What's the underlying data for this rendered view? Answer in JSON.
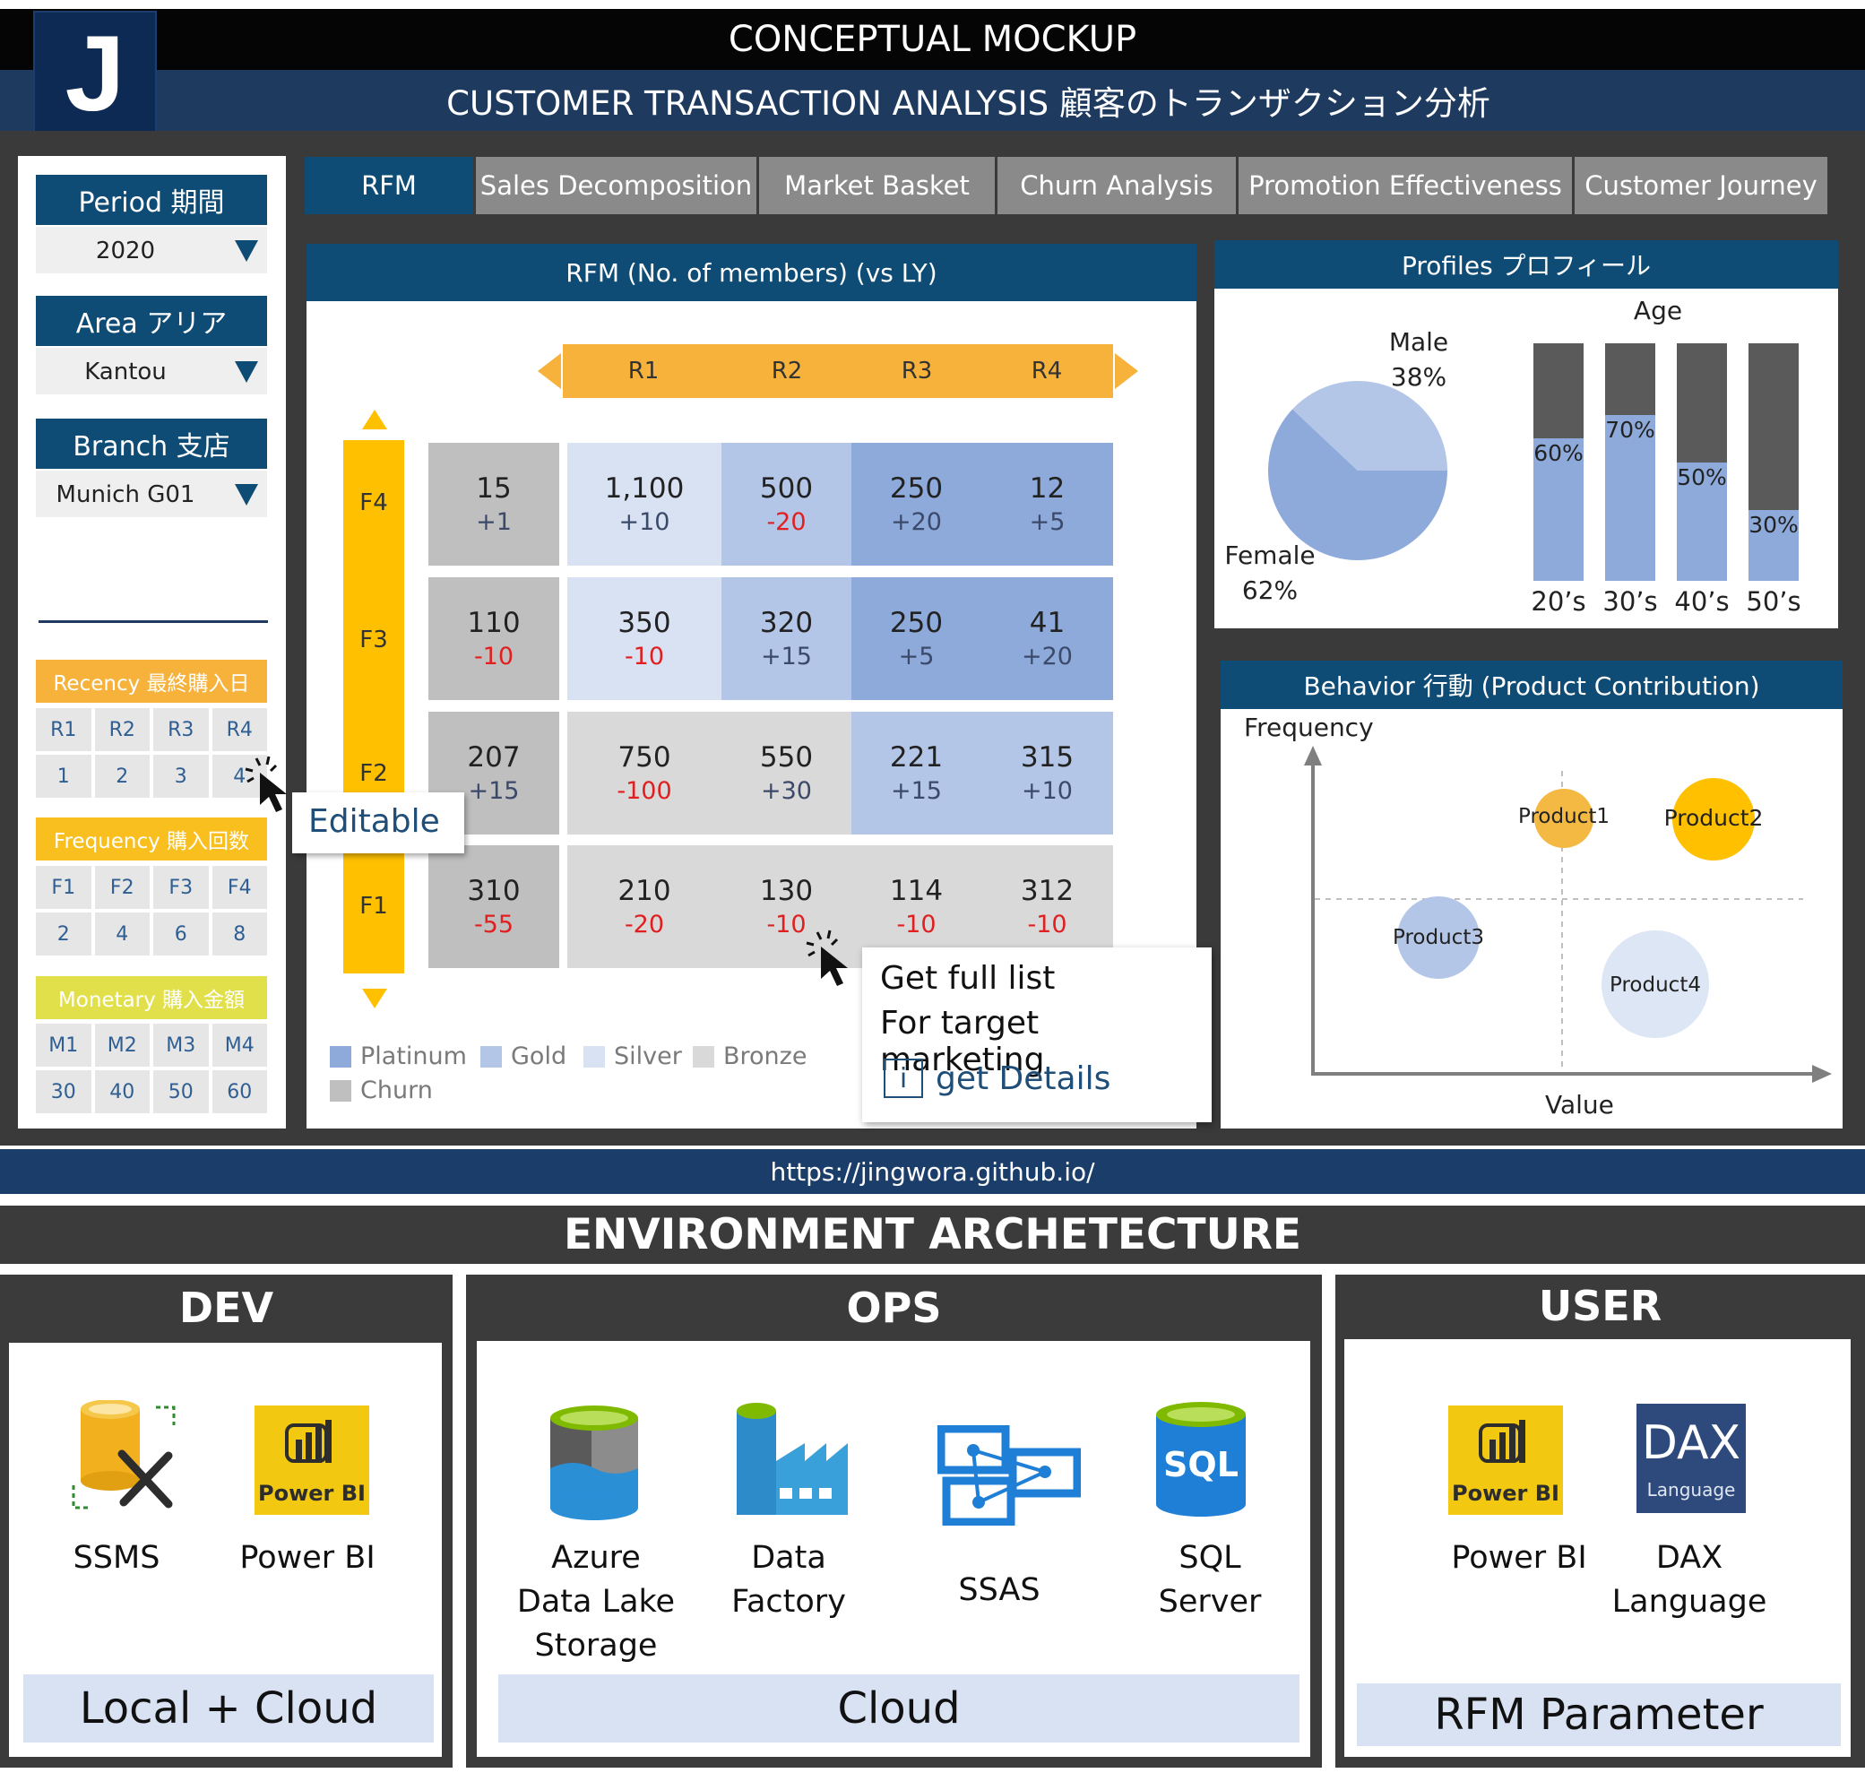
{
  "header": {
    "title": "CONCEPTUAL MOCKUP",
    "subtitle": "CUSTOMER TRANSACTION ANALYSIS 顧客のトランザクション分析",
    "logo_letter": "J"
  },
  "filters": {
    "period": {
      "label": "Period 期間",
      "value": "2020"
    },
    "area": {
      "label": "Area アリア",
      "value": "Kantou"
    },
    "branch": {
      "label": "Branch 支店",
      "value": "Munich G01"
    }
  },
  "params": {
    "recency": {
      "label": "Recency 最終購入日",
      "color": "#f6b23a",
      "headers": [
        "R1",
        "R2",
        "R3",
        "R4"
      ],
      "values": [
        "1",
        "2",
        "3",
        "4"
      ]
    },
    "frequency": {
      "label": "Frequency 購入回数",
      "color": "#f8bf1e",
      "headers": [
        "F1",
        "F2",
        "F3",
        "F4"
      ],
      "values": [
        "2",
        "4",
        "6",
        "8"
      ]
    },
    "monetary": {
      "label": "Monetary 購入金額",
      "color": "#e2e04a",
      "headers": [
        "M1",
        "M2",
        "M3",
        "M4"
      ],
      "values": [
        "30",
        "40",
        "50",
        "60"
      ]
    }
  },
  "editable_callout": "Editable",
  "tabs": [
    "RFM",
    "Sales Decomposition",
    "Market Basket",
    "Churn Analysis",
    "Promotion Effectiveness",
    "Customer Journey"
  ],
  "rfm": {
    "title": "RFM (No. of members) (vs LY)",
    "r_labels": [
      "R1",
      "R2",
      "R3",
      "R4"
    ],
    "f_labels": [
      "F4",
      "F3",
      "F2",
      "F1"
    ],
    "rows": [
      [
        {
          "v": "15",
          "d": "+1"
        },
        {
          "v": "1,100",
          "d": "+10"
        },
        {
          "v": "500",
          "d": "-20"
        },
        {
          "v": "250",
          "d": "+20"
        },
        {
          "v": "12",
          "d": "+5"
        }
      ],
      [
        {
          "v": "110",
          "d": "-10"
        },
        {
          "v": "350",
          "d": "-10"
        },
        {
          "v": "320",
          "d": "+15"
        },
        {
          "v": "250",
          "d": "+5"
        },
        {
          "v": "41",
          "d": "+20"
        }
      ],
      [
        {
          "v": "207",
          "d": "+15"
        },
        {
          "v": "750",
          "d": "-100"
        },
        {
          "v": "550",
          "d": "+30"
        },
        {
          "v": "221",
          "d": "+15"
        },
        {
          "v": "315",
          "d": "+10"
        }
      ],
      [
        {
          "v": "310",
          "d": "-55"
        },
        {
          "v": "210",
          "d": "-20"
        },
        {
          "v": "130",
          "d": "-10"
        },
        {
          "v": "114",
          "d": "-10"
        },
        {
          "v": "312",
          "d": "-10"
        }
      ]
    ],
    "legend": [
      {
        "label": "Platinum",
        "color": "#8eaadb"
      },
      {
        "label": "Gold",
        "color": "#b4c6e7"
      },
      {
        "label": "Silver",
        "color": "#d9e2f3"
      },
      {
        "label": "Bronze",
        "color": "#d9d9d9"
      },
      {
        "label": "Churn",
        "color": "#bfbfbf"
      }
    ]
  },
  "callout": {
    "line1": "Get full list",
    "line2": "For target marketing",
    "link": "get Details",
    "info_icon": "i"
  },
  "profiles": {
    "title": "Profiles プロフィール",
    "gender": [
      {
        "label": "Male",
        "percent": "38%",
        "value": 38
      },
      {
        "label": "Female",
        "percent": "62%",
        "value": 62
      }
    ],
    "age_title": "Age",
    "age": [
      {
        "label": "20’s",
        "percent": "60%",
        "value": 60
      },
      {
        "label": "30’s",
        "percent": "70%",
        "value": 70
      },
      {
        "label": "40’s",
        "percent": "50%",
        "value": 50
      },
      {
        "label": "50’s",
        "percent": "30%",
        "value": 30
      }
    ]
  },
  "behavior": {
    "title": "Behavior 行動  (Product Contribution)",
    "y_label": "Frequency",
    "x_label": "Value",
    "products": [
      {
        "label": "Product1",
        "color": "#f4b942"
      },
      {
        "label": "Product2",
        "color": "#ffc000"
      },
      {
        "label": "Product3",
        "color": "#b4c6e7"
      },
      {
        "label": "Product4",
        "color": "#dce6f4"
      }
    ]
  },
  "footer_url": "https://jingwora.github.io/",
  "environment": {
    "title": "ENVIRONMENT ARCHETECTURE",
    "dev": {
      "title": "DEV",
      "tools": [
        "SSMS",
        "Power BI"
      ],
      "footer": "Local + Cloud"
    },
    "ops": {
      "title": "OPS",
      "tools": [
        "Azure Data Lake Storage",
        "Data Factory",
        "SSAS",
        "SQL Server"
      ],
      "footer": "Cloud"
    },
    "user": {
      "title": "USER",
      "tools": [
        "Power BI",
        "DAX Language"
      ],
      "footer": "RFM Parameter"
    },
    "icon_texts": {
      "powerbi": "Power BI",
      "dax_big": "DAX",
      "dax_small": "Language",
      "sql": "SQL"
    }
  }
}
